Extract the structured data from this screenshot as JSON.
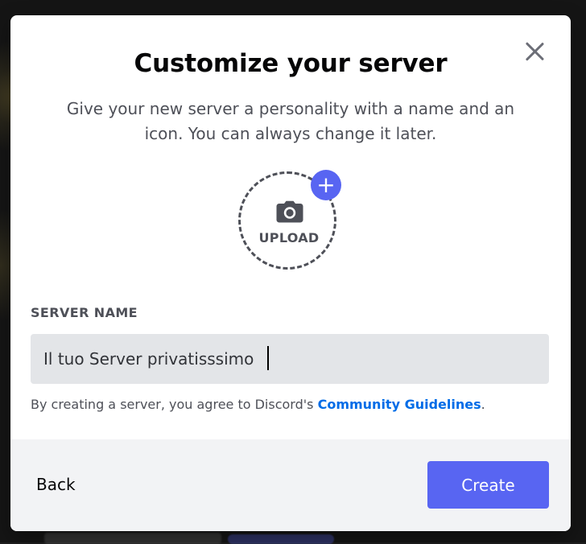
{
  "modal": {
    "title": "Customize your server",
    "subtitle": "Give your new server a personality with a name and an icon. You can always change it later."
  },
  "upload": {
    "label": "UPLOAD",
    "plus": "+"
  },
  "server_name": {
    "label": "SERVER NAME",
    "value": "Il tuo Server privatisssimo"
  },
  "guidelines": {
    "prefix": "By creating a server, you agree to Discord's ",
    "link": "Community Guidelines",
    "suffix": "."
  },
  "footer": {
    "back_label": "Back",
    "create_label": "Create"
  },
  "colors": {
    "accent": "#5865f2",
    "link": "#006ce7",
    "input_bg": "#e3e5e8",
    "footer_bg": "#f2f3f5"
  },
  "icons": {
    "close": "close-icon",
    "camera": "camera-icon",
    "plus": "plus-icon"
  }
}
